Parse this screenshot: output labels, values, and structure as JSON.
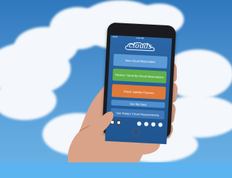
{
  "app": {
    "logo_text": "clouds",
    "status_left": "AT&T",
    "status_time": "2:36 PM"
  },
  "buttons": [
    {
      "label": "New Cloud Observation"
    },
    {
      "label": "Review / Send My Cloud Observations"
    },
    {
      "label": "Check Satellite Flyovers"
    },
    {
      "label": "See My Data"
    },
    {
      "label": "See Today's Cloud Measurements"
    }
  ],
  "toolbar": {
    "icons": [
      "grid-icon",
      "list-icon",
      "settings-icon",
      "refresh-icon",
      "info-icon",
      "help-icon"
    ]
  },
  "colors": {
    "sky": "#4a90cf",
    "button_blue": "#5d9bd6",
    "button_green": "#5fb14a",
    "button_orange": "#e07a3a",
    "bottom_bar": "#5bb3ef"
  }
}
